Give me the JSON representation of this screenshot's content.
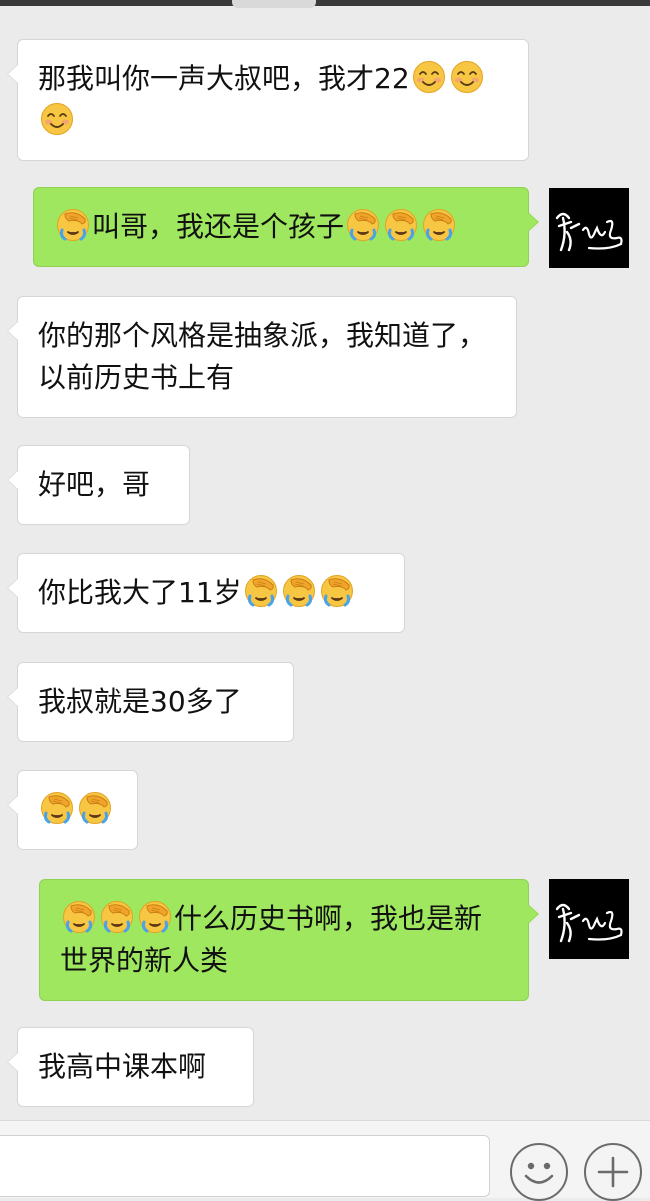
{
  "conversation": {
    "messages": [
      {
        "side": "in",
        "text": "那我叫你一声大叔吧，我才22",
        "emoji_before": 0,
        "emoji_after": 3,
        "emoji": "smiling-blush-emoji"
      },
      {
        "side": "out",
        "text": "叫哥，我还是个孩子",
        "emoji_before": 1,
        "emoji_after": 3,
        "emoji": "facepalm-tears-emoji"
      },
      {
        "side": "in",
        "text": "你的那个风格是抽象派，我知道了，以前历史书上有",
        "emoji_before": 0,
        "emoji_after": 0
      },
      {
        "side": "in",
        "text": "好吧，哥",
        "emoji_before": 0,
        "emoji_after": 0
      },
      {
        "side": "in",
        "text": "你比我大了11岁",
        "emoji_before": 0,
        "emoji_after": 3,
        "emoji": "facepalm-tears-emoji"
      },
      {
        "side": "in",
        "text": "我叔就是30多了",
        "emoji_before": 0,
        "emoji_after": 0
      },
      {
        "side": "in",
        "text": "",
        "emoji_before": 2,
        "emoji_after": 0,
        "emoji": "facepalm-tears-emoji"
      },
      {
        "side": "out",
        "text": "什么历史书啊，我也是新世界的新人类",
        "emoji_before": 3,
        "emoji_after": 0,
        "emoji": "facepalm-tears-emoji"
      },
      {
        "side": "in",
        "text": "我高中课本啊",
        "emoji_before": 0,
        "emoji_after": 0
      }
    ]
  },
  "input_bar": {
    "placeholder": "",
    "emoji_button_icon": "smiley-face-icon",
    "more_button_icon": "plus-icon"
  },
  "colors": {
    "background": "#ebebeb",
    "incoming_bubble": "#ffffff",
    "outgoing_bubble": "#9ee75f",
    "avatar_bg": "#000000"
  }
}
